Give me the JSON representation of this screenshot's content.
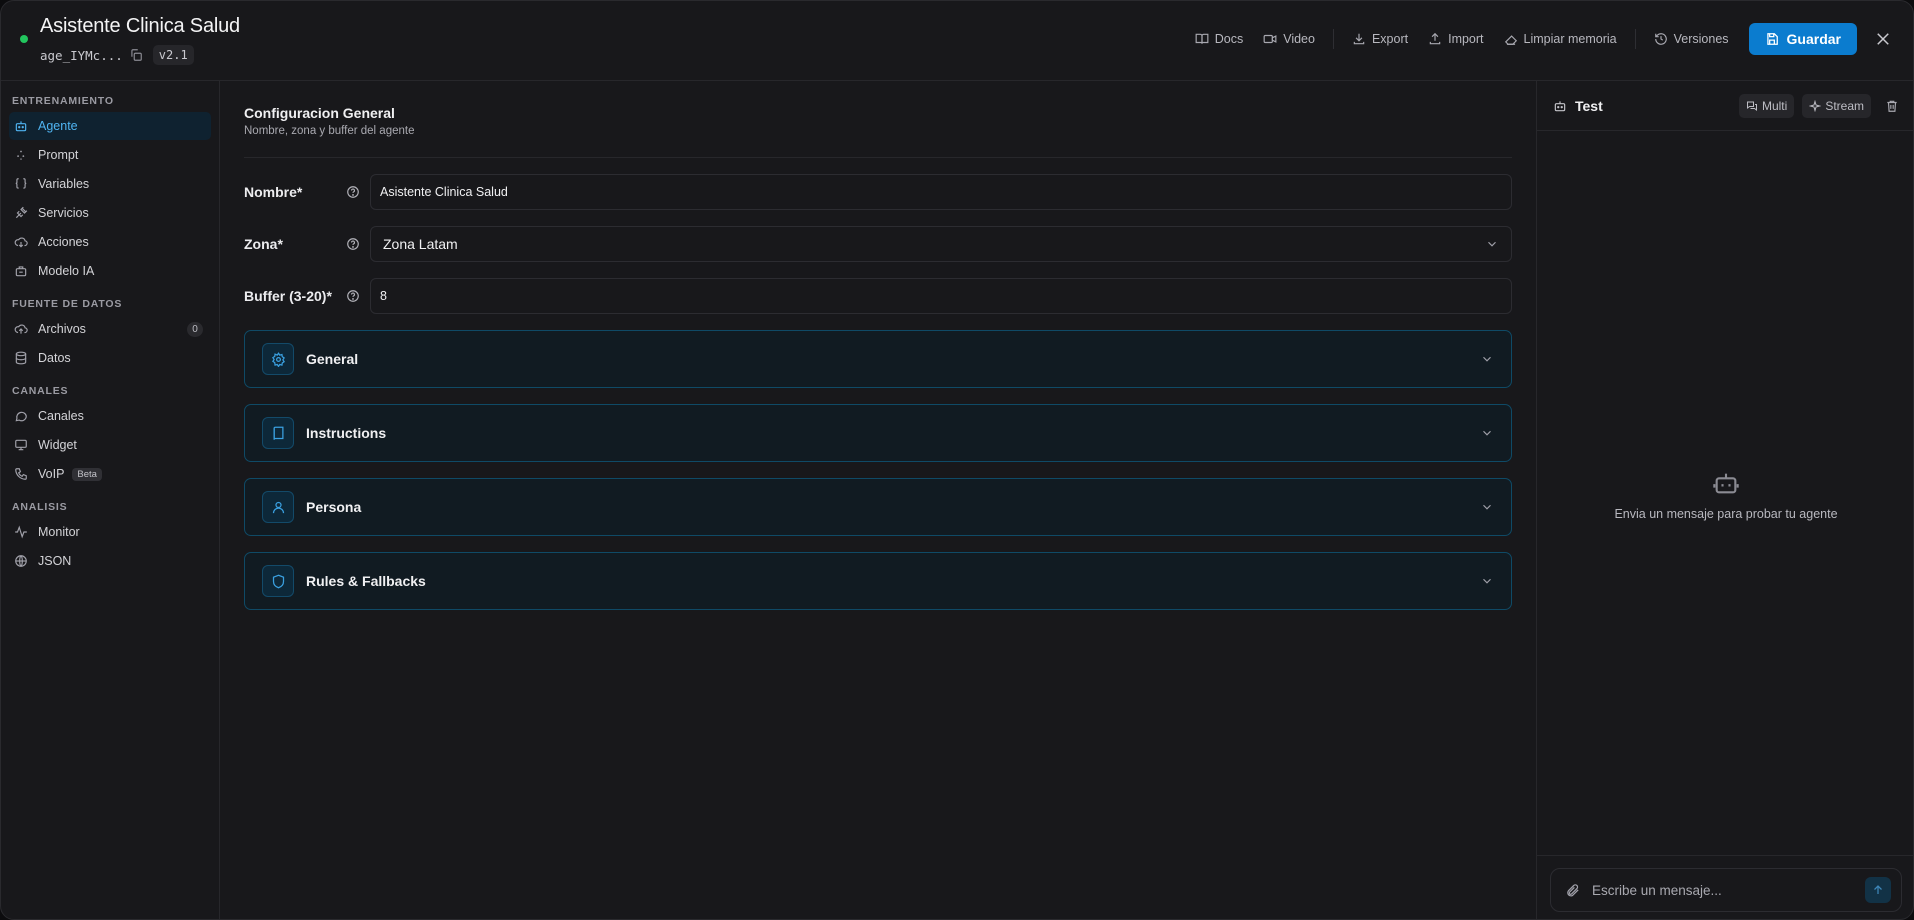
{
  "header": {
    "title": "Asistente Clinica Salud",
    "agent_id": "age_IYMc...",
    "version": "v2.1",
    "toolbar": {
      "docs": "Docs",
      "video": "Video",
      "export": "Export",
      "import": "Import",
      "clear_memory": "Limpiar memoria",
      "versions": "Versiones",
      "save": "Guardar"
    }
  },
  "sidebar": {
    "sections": [
      {
        "title": "ENTRENAMIENTO",
        "items": [
          {
            "label": "Agente",
            "icon": "bot-icon",
            "active": true
          },
          {
            "label": "Prompt",
            "icon": "sparkle-icon"
          },
          {
            "label": "Variables",
            "icon": "braces-icon"
          },
          {
            "label": "Servicios",
            "icon": "plug-icon"
          },
          {
            "label": "Acciones",
            "icon": "cloud-icon"
          },
          {
            "label": "Modelo IA",
            "icon": "chip-icon"
          }
        ]
      },
      {
        "title": "FUENTE DE DATOS",
        "items": [
          {
            "label": "Archivos",
            "icon": "upload-cloud-icon",
            "count": "0"
          },
          {
            "label": "Datos",
            "icon": "database-icon"
          }
        ]
      },
      {
        "title": "CANALES",
        "items": [
          {
            "label": "Canales",
            "icon": "chat-icon"
          },
          {
            "label": "Widget",
            "icon": "monitor-icon"
          },
          {
            "label": "VoIP",
            "icon": "phone-icon",
            "badge": "Beta"
          }
        ]
      },
      {
        "title": "ANALISIS",
        "items": [
          {
            "label": "Monitor",
            "icon": "activity-icon"
          },
          {
            "label": "JSON",
            "icon": "globe-icon"
          }
        ]
      }
    ]
  },
  "main": {
    "title": "Configuracion General",
    "subtitle": "Nombre, zona y buffer del agente",
    "fields": {
      "name_label": "Nombre*",
      "name_value": "Asistente Clinica Salud",
      "zone_label": "Zona*",
      "zone_value": "Zona Latam",
      "buffer_label": "Buffer (3-20)*",
      "buffer_value": "8"
    },
    "sections": [
      {
        "label": "General",
        "icon": "gear-icon"
      },
      {
        "label": "Instructions",
        "icon": "book-icon"
      },
      {
        "label": "Persona",
        "icon": "user-icon"
      },
      {
        "label": "Rules & Fallbacks",
        "icon": "shield-icon"
      }
    ]
  },
  "test_panel": {
    "title": "Test",
    "multi": "Multi",
    "stream": "Stream",
    "empty_message": "Envia un mensaje para probar tu agente",
    "input_placeholder": "Escribe un mensaje..."
  },
  "colors": {
    "accent": "#0b7ccf",
    "active_nav_text": "#4fb3f0",
    "status_dot": "#22c55e",
    "accordion_border": "#0f4a66"
  }
}
